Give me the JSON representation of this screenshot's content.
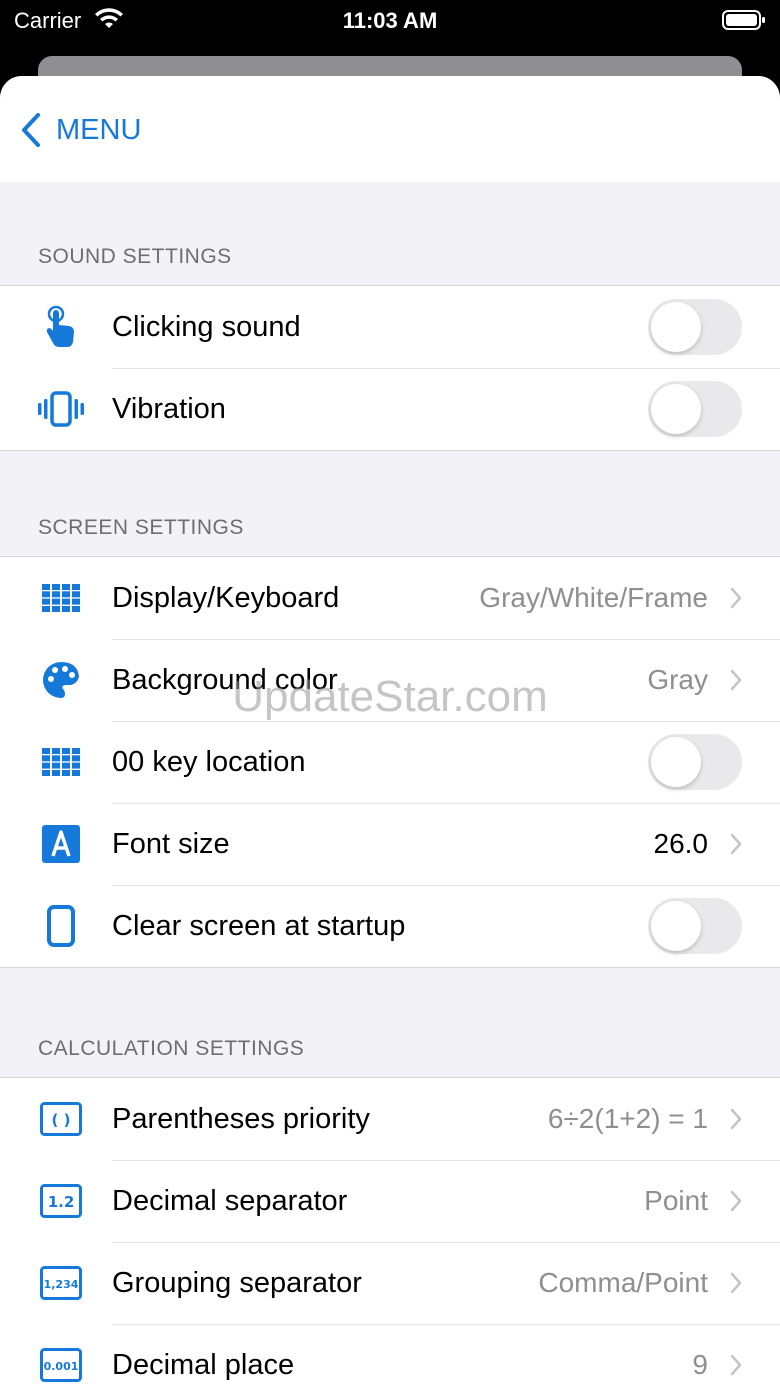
{
  "status": {
    "carrier": "Carrier",
    "time": "11:03 AM"
  },
  "nav": {
    "back_label": "MENU"
  },
  "sections": {
    "sound": {
      "title": "SOUND SETTINGS",
      "rows": [
        {
          "label": "Clicking sound",
          "icon": "tap-finger-icon",
          "control": "toggle",
          "on": false
        },
        {
          "label": "Vibration",
          "icon": "vibration-icon",
          "control": "toggle",
          "on": false
        }
      ]
    },
    "screen": {
      "title": "SCREEN SETTINGS",
      "rows": [
        {
          "label": "Display/Keyboard",
          "icon": "keypad-grid-icon",
          "value": "Gray/White/Frame"
        },
        {
          "label": "Background color",
          "icon": "palette-icon",
          "value": "Gray"
        },
        {
          "label": "00 key location",
          "icon": "keypad-grid-icon",
          "control": "toggle",
          "on": false
        },
        {
          "label": "Font size",
          "icon": "font-a-icon",
          "value": "26.0"
        },
        {
          "label": "Clear screen at startup",
          "icon": "phone-screen-icon",
          "control": "toggle",
          "on": false
        }
      ]
    },
    "calculation": {
      "title": "CALCULATION SETTINGS",
      "rows": [
        {
          "label": "Parentheses priority",
          "icon": "parentheses-icon",
          "icon_text": "( )",
          "value": "6÷2(1+2) = 1"
        },
        {
          "label": "Decimal separator",
          "icon": "decimal-separator-icon",
          "icon_text": "1.2",
          "value": "Point"
        },
        {
          "label": "Grouping separator",
          "icon": "grouping-separator-icon",
          "icon_text": "1,234",
          "value": "Comma/Point"
        },
        {
          "label": "Decimal place",
          "icon": "decimal-place-icon",
          "icon_text": "0.001",
          "value": "9"
        }
      ]
    }
  },
  "watermark": "UpdateStar.com",
  "colors": {
    "accent": "#1479d8",
    "background": "#f2f2f7",
    "secondary_text": "#8e8e93"
  }
}
